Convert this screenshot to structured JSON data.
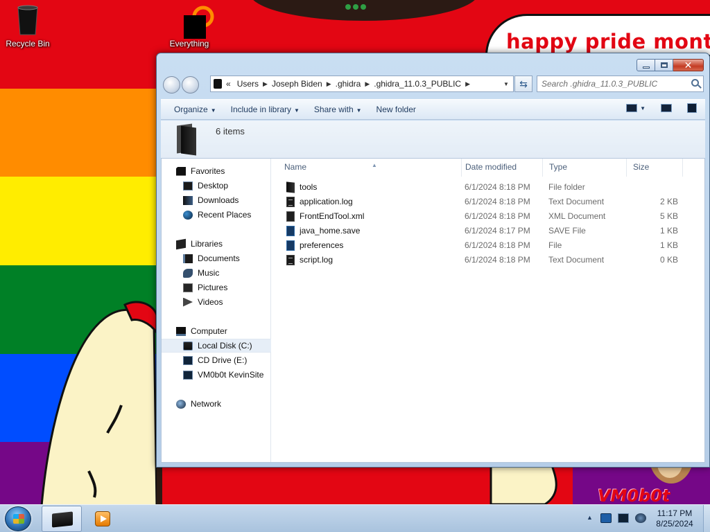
{
  "desktop": {
    "icons": [
      {
        "label": "Recycle Bin",
        "icon": "recycle-bin-icon"
      },
      {
        "label": "Everything",
        "icon": "everything-search-icon"
      }
    ],
    "banner_text": "happy pride month",
    "watermark_text": "VM0b0t",
    "stripe_colors": [
      "#e30613",
      "#ff8c00",
      "#ffed00",
      "#008026",
      "#004dff",
      "#750787"
    ]
  },
  "window": {
    "title": "",
    "address": {
      "prefix": "«",
      "crumbs": [
        "Users",
        "Joseph Biden",
        ".ghidra",
        ".ghidra_11.0.3_PUBLIC"
      ]
    },
    "search": {
      "placeholder": "Search .ghidra_11.0.3_PUBLIC"
    },
    "toolbar": {
      "organize": "Organize",
      "include_in_library": "Include in library",
      "share_with": "Share with",
      "new_folder": "New folder"
    },
    "info": {
      "items_count": "6 items"
    },
    "nav_pane": {
      "favorites": {
        "label": "Favorites",
        "items": [
          "Desktop",
          "Downloads",
          "Recent Places"
        ]
      },
      "libraries": {
        "label": "Libraries",
        "items": [
          "Documents",
          "Music",
          "Pictures",
          "Videos"
        ]
      },
      "computer": {
        "label": "Computer",
        "items": [
          "Local Disk (C:)",
          "CD Drive (E:)",
          "VM0b0t KevinSite"
        ],
        "selected": "Local Disk (C:)"
      },
      "network": {
        "label": "Network"
      }
    },
    "columns": {
      "name": "Name",
      "date_modified": "Date modified",
      "type": "Type",
      "size": "Size"
    },
    "files": [
      {
        "name": "tools",
        "date": "6/1/2024 8:18 PM",
        "type": "File folder",
        "size": "",
        "icon": "folder-icon"
      },
      {
        "name": "application.log",
        "date": "6/1/2024 8:18 PM",
        "type": "Text Document",
        "size": "2 KB",
        "icon": "text-file-icon"
      },
      {
        "name": "FrontEndTool.xml",
        "date": "6/1/2024 8:18 PM",
        "type": "XML Document",
        "size": "5 KB",
        "icon": "xml-file-icon"
      },
      {
        "name": "java_home.save",
        "date": "6/1/2024 8:17 PM",
        "type": "SAVE File",
        "size": "1 KB",
        "icon": "generic-file-icon"
      },
      {
        "name": "preferences",
        "date": "6/1/2024 8:18 PM",
        "type": "File",
        "size": "1 KB",
        "icon": "generic-file-icon"
      },
      {
        "name": "script.log",
        "date": "6/1/2024 8:18 PM",
        "type": "Text Document",
        "size": "0 KB",
        "icon": "text-file-icon"
      }
    ]
  },
  "taskbar": {
    "clock_time": "11:17 PM",
    "clock_date": "8/25/2024"
  }
}
